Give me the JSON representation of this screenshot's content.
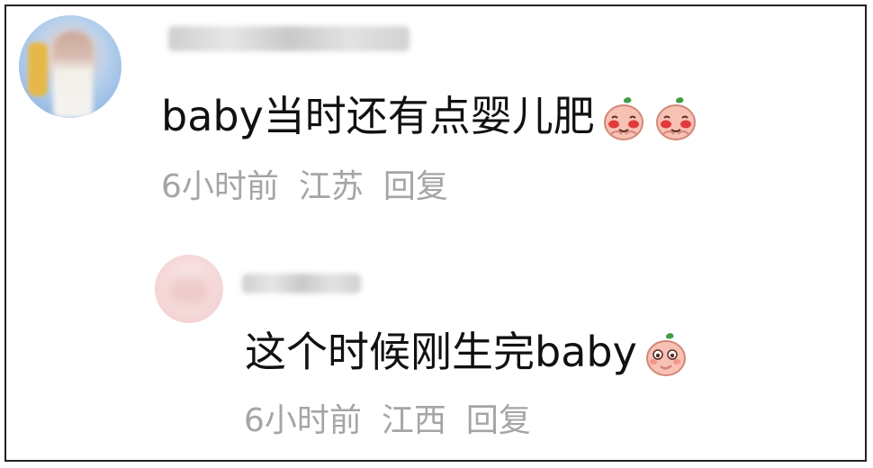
{
  "comment": {
    "text": "baby当时还有点婴儿肥",
    "emojis": [
      "blushing-peach-emoji",
      "blushing-peach-emoji"
    ],
    "time": "6小时前",
    "location": "江苏",
    "reply_label": "回复"
  },
  "reply": {
    "text": "这个时候刚生完baby",
    "emojis": [
      "thinking-peach-emoji"
    ],
    "time": "6小时前",
    "location": "江西",
    "reply_label": "回复"
  },
  "colors": {
    "text": "#111111",
    "meta": "#a5a5a5",
    "frame_border": "#222222",
    "peach": "#f7c1b4",
    "peach_blush": "#e03a3a",
    "leaf": "#3f9e47"
  }
}
